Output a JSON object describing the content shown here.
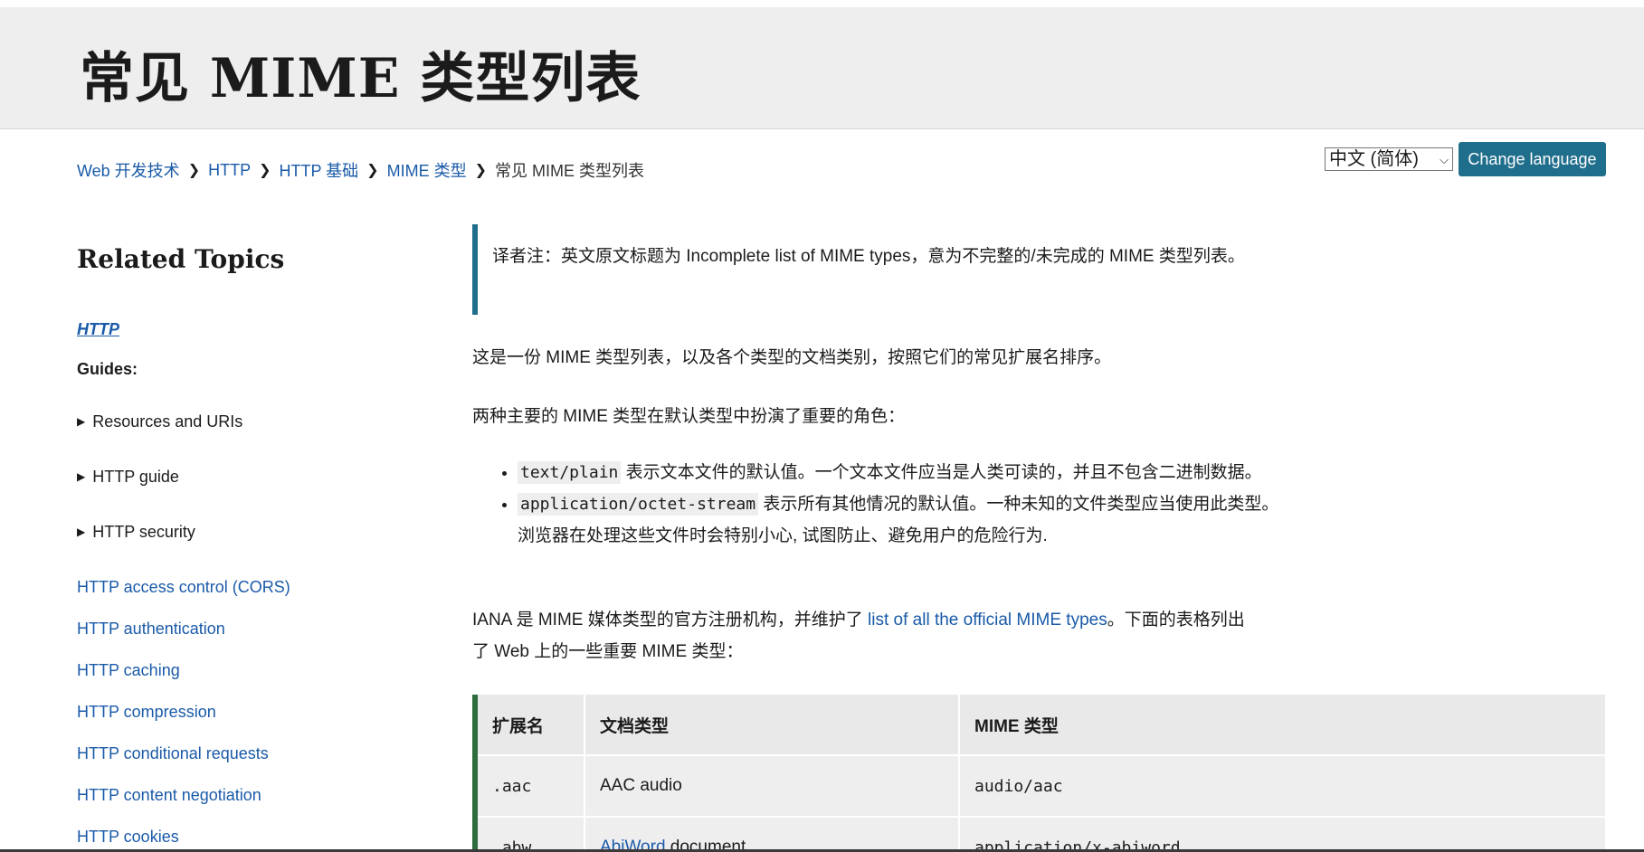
{
  "header": {
    "title": "常见 MIME 类型列表"
  },
  "breadcrumb": {
    "items": [
      "Web 开发技术",
      "HTTP",
      "HTTP 基础",
      "MIME 类型"
    ],
    "current": "常见 MIME 类型列表"
  },
  "language": {
    "selected": "中文 (简体)",
    "button_label": "Change language"
  },
  "sidebar": {
    "title": "Related Topics",
    "top_link": "HTTP",
    "guides_label": "Guides:",
    "sections": [
      "Resources and URIs",
      "HTTP guide",
      "HTTP security"
    ],
    "links": [
      "HTTP access control (CORS)",
      "HTTP authentication",
      "HTTP caching",
      "HTTP compression",
      "HTTP conditional requests",
      "HTTP content negotiation",
      "HTTP cookies"
    ]
  },
  "content": {
    "note": "译者注：英文原文标题为 Incomplete list of MIME types，意为不完整的/未完成的 MIME 类型列表。",
    "intro": "这是一份 MIME 类型列表，以及各个类型的文档类别，按照它们的常见扩展名排序。",
    "two_main": "两种主要的 MIME 类型在默认类型中扮演了重要的角色：",
    "bullets": [
      {
        "code": "text/plain",
        "text": " 表示文本文件的默认值。一个文本文件应当是人类可读的，并且不包含二进制数据。"
      },
      {
        "code": "application/octet-stream",
        "text": " 表示所有其他情况的默认值。一种未知的文件类型应当使用此类型。浏览器在处理这些文件时会特别小心, 试图防止、避免用户的危险行为."
      }
    ],
    "iana_before": "IANA 是 MIME 媒体类型的官方注册机构，并维护了 ",
    "iana_link": "list of all the official MIME types",
    "iana_after": "。下面的表格列出了 Web 上的一些重要 MIME 类型："
  },
  "table": {
    "headers": [
      "扩展名",
      "文档类型",
      "MIME 类型"
    ],
    "rows": [
      {
        "ext": ".aac",
        "doc": "AAC audio",
        "doc_link": "",
        "mime": "audio/aac"
      },
      {
        "ext": ".abw",
        "doc": " document",
        "doc_link": "AbiWord",
        "mime": "application/x-abiword"
      }
    ]
  }
}
